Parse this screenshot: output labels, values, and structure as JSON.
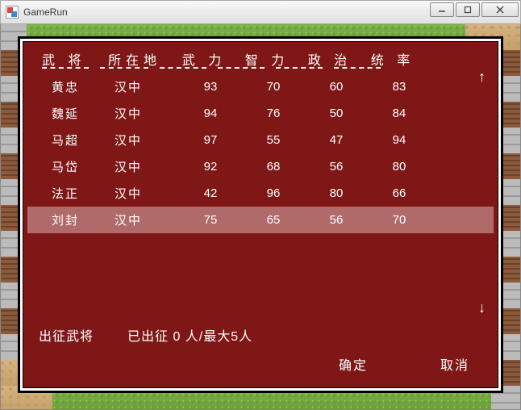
{
  "window": {
    "title": "GameRun"
  },
  "panel": {
    "headers": {
      "name": "武 将",
      "location": "所在地",
      "force": "武 力",
      "intel": "智 力",
      "politics": "政 治",
      "leadership": "统 率"
    },
    "rows": [
      {
        "name": "黄忠",
        "location": "汉中",
        "force": 93,
        "intel": 70,
        "politics": 60,
        "leadership": 83,
        "selected": false
      },
      {
        "name": "魏延",
        "location": "汉中",
        "force": 94,
        "intel": 76,
        "politics": 50,
        "leadership": 84,
        "selected": false
      },
      {
        "name": "马超",
        "location": "汉中",
        "force": 97,
        "intel": 55,
        "politics": 47,
        "leadership": 94,
        "selected": false
      },
      {
        "name": "马岱",
        "location": "汉中",
        "force": 92,
        "intel": 68,
        "politics": 56,
        "leadership": 80,
        "selected": false
      },
      {
        "name": "法正",
        "location": "汉中",
        "force": 42,
        "intel": 96,
        "politics": 80,
        "leadership": 66,
        "selected": false
      },
      {
        "name": "刘封",
        "location": "汉中",
        "force": 75,
        "intel": 65,
        "politics": 56,
        "leadership": 70,
        "selected": true
      }
    ],
    "scroll": {
      "up": "↑",
      "down": "↓"
    },
    "footer": {
      "label": "出征武将",
      "status_prefix": "已出征 ",
      "count": 0,
      "status_mid": " 人/最大",
      "max": 5,
      "status_suffix": "人"
    },
    "buttons": {
      "ok": "确定",
      "cancel": "取消"
    }
  }
}
